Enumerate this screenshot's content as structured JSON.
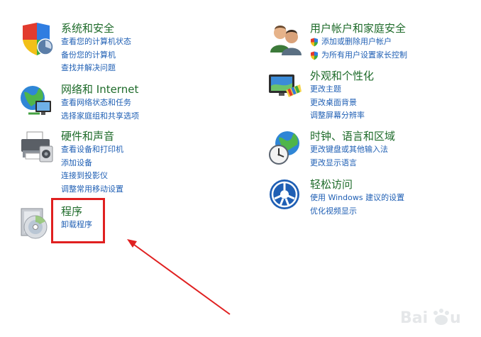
{
  "categories": {
    "system": {
      "title": "系统和安全",
      "links": [
        "查看您的计算机状态",
        "备份您的计算机",
        "查找并解决问题"
      ],
      "icon": "shield-icon"
    },
    "network": {
      "title": "网络和 Internet",
      "links": [
        "查看网络状态和任务",
        "选择家庭组和共享选项"
      ],
      "icon": "globe-network-icon"
    },
    "hardware": {
      "title": "硬件和声音",
      "links": [
        "查看设备和打印机",
        "添加设备",
        "连接到投影仪",
        "调整常用移动设置"
      ],
      "icon": "printer-icon"
    },
    "programs": {
      "title": "程序",
      "links": [
        "卸载程序"
      ],
      "icon": "programs-disc-icon"
    },
    "users": {
      "title": "用户帐户和家庭安全",
      "links": [
        "添加或删除用户帐户",
        "为所有用户设置家长控制"
      ],
      "icon": "users-icon"
    },
    "appearance": {
      "title": "外观和个性化",
      "links": [
        "更改主题",
        "更改桌面背景",
        "调整屏幕分辨率"
      ],
      "icon": "monitor-palette-icon"
    },
    "clock": {
      "title": "时钟、语言和区域",
      "links": [
        "更改键盘或其他输入法",
        "更改显示语言"
      ],
      "icon": "globe-clock-icon"
    },
    "ease": {
      "title": "轻松访问",
      "links": [
        "使用 Windows 建议的设置",
        "优化视频显示"
      ],
      "icon": "ease-of-access-icon"
    }
  },
  "annotation": {
    "highlight_color": "#e02020"
  },
  "watermark": {
    "text": "Baidu经验"
  }
}
